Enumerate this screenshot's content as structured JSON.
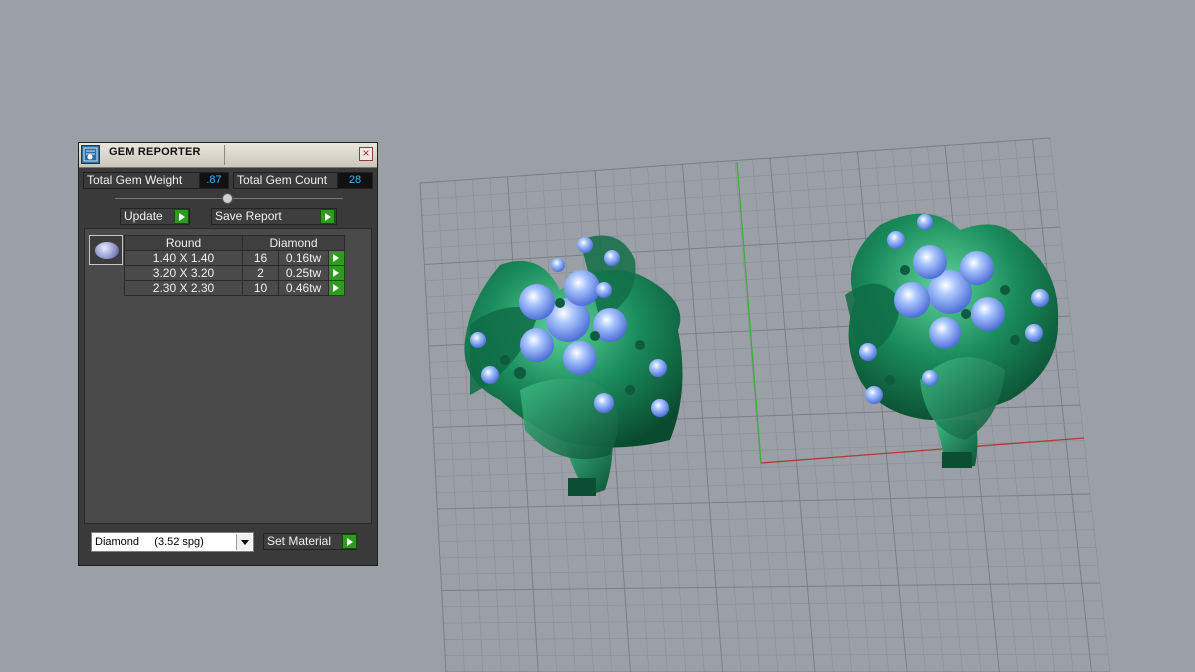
{
  "panel": {
    "title": "GEM REPORTER",
    "close_icon": "close-icon",
    "total_weight_label": "Total Gem Weight",
    "total_weight_value": ".87",
    "total_count_label": "Total Gem Count",
    "total_count_value": "28",
    "update_label": "Update",
    "save_report_label": "Save Report",
    "table": {
      "headers": [
        "Round",
        "Diamond"
      ],
      "rows": [
        {
          "size": "1.40 X 1.40",
          "count": "16",
          "weight": "0.16tw"
        },
        {
          "size": "3.20 X 3.20",
          "count": "2",
          "weight": "0.25tw"
        },
        {
          "size": "2.30 X 2.30",
          "count": "10",
          "weight": "0.46tw"
        }
      ]
    },
    "material_select_value": "Diamond     (3.52 spg)",
    "set_material_label": "Set Material"
  },
  "colors": {
    "accent_green": "#2f9a1f",
    "value_blue": "#42b6ff",
    "metal_green": "#1f8a5e",
    "gem_blue": "#8fb6ff",
    "viewport_bg": "#9aa0a6"
  }
}
